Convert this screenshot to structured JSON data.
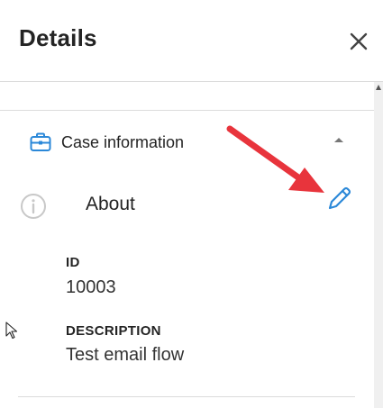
{
  "header": {
    "title": "Details"
  },
  "icons": {
    "close": "close-icon",
    "section": "briefcase-icon",
    "info": "info-icon",
    "edit": "pencil-icon",
    "collapse": "caret-up-icon",
    "cursor": "mouse-cursor-icon"
  },
  "section": {
    "title": "Case information",
    "subheading": "About",
    "fields": [
      {
        "label": "ID",
        "value": "10003"
      },
      {
        "label": "DESCRIPTION",
        "value": "Test email flow"
      }
    ]
  },
  "colors": {
    "accent": "#2b88d8",
    "annotation_arrow": "#e8343c",
    "info_icon": "#c8c8c8",
    "divider": "#dcdcdc"
  }
}
